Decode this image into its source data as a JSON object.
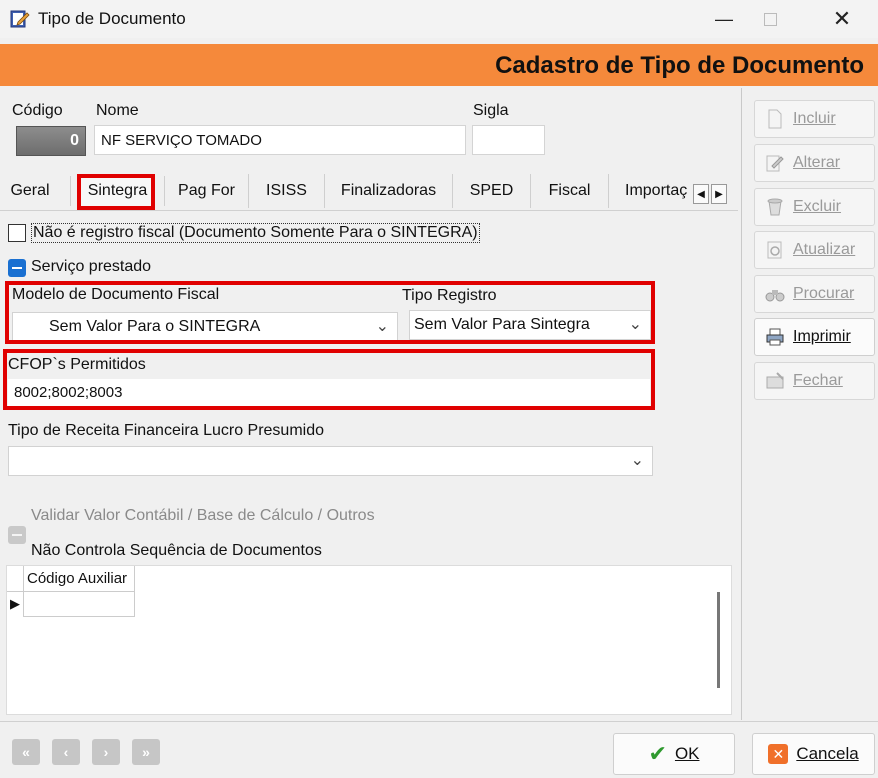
{
  "window": {
    "title": "Tipo de Documento"
  },
  "header": {
    "title": "Cadastro de Tipo de Documento"
  },
  "fields": {
    "codigo_label": "Código",
    "codigo_value": "0",
    "nome_label": "Nome",
    "nome_value": "NF SERVIÇO TOMADO",
    "sigla_label": "Sigla",
    "sigla_value": ""
  },
  "tabs": [
    {
      "label": "Geral"
    },
    {
      "label": "Sintegra"
    },
    {
      "label": "Pag For"
    },
    {
      "label": "ISISS"
    },
    {
      "label": "Finalizadoras"
    },
    {
      "label": "SPED"
    },
    {
      "label": "Fiscal"
    },
    {
      "label": "Importaç"
    }
  ],
  "sintegra": {
    "nao_registro_label": "Não é registro fiscal (Documento Somente Para o SINTEGRA)",
    "servico_prestado_label": "Serviço prestado",
    "modelo_label": "Modelo de Documento Fiscal",
    "modelo_value": "Sem Valor Para o SINTEGRA",
    "tipo_registro_label": "Tipo Registro",
    "tipo_registro_value": "Sem Valor Para Sintegra",
    "cfop_label": "CFOP`s Permitidos",
    "cfop_value": "8002;8002;8003",
    "tipo_receita_label": "Tipo de Receita Financeira Lucro Presumido",
    "tipo_receita_value": "",
    "validar_label": "Validar Valor Contábil / Base de Cálculo / Outros",
    "nao_controla_label": "Não Controla Sequência de Documentos",
    "grid_header": "Código Auxiliar"
  },
  "sidebar": {
    "incluir": "Incluir",
    "alterar": "Alterar",
    "excluir": "Excluir",
    "atualizar": "Atualizar",
    "procurar": "Procurar",
    "imprimir": "Imprimir",
    "fechar": "Fechar"
  },
  "footer": {
    "ok": "OK",
    "cancela": "Cancela"
  },
  "colors": {
    "header_bg": "#f5893b",
    "highlight": "#e00000",
    "check_blue": "#1a70d1"
  }
}
